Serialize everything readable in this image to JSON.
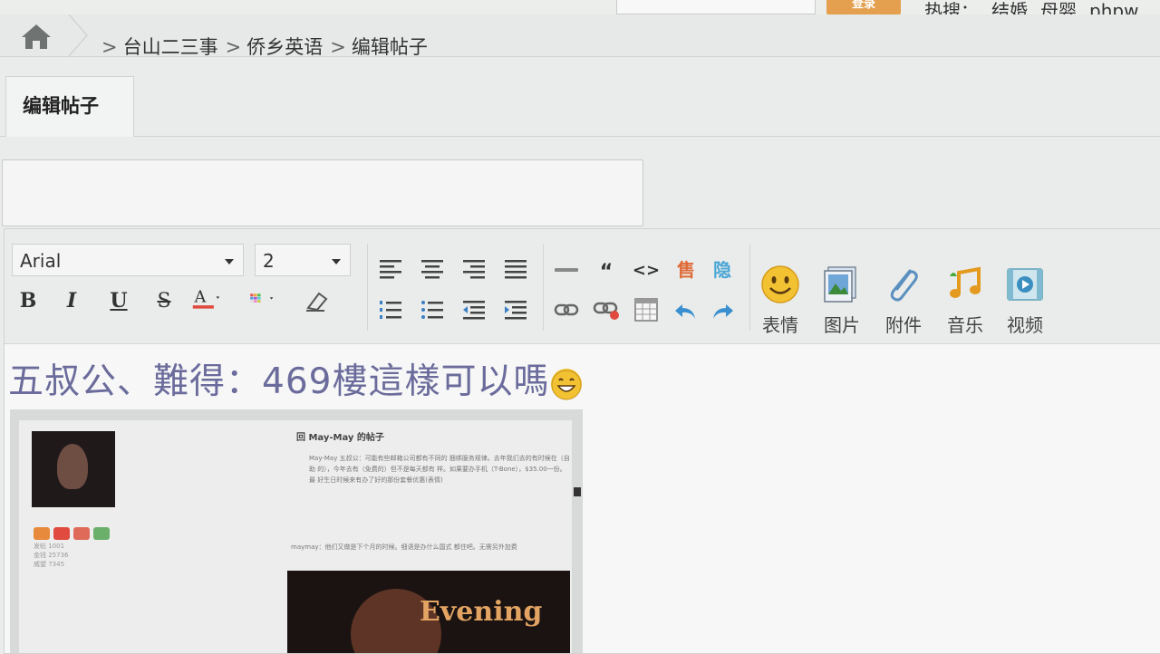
{
  "topbar": {
    "search_button": "登录",
    "hot_label": "热搜：",
    "hot_links": [
      "结婚",
      "母婴",
      "phpw"
    ]
  },
  "breadcrumb": {
    "separator": ">",
    "items": [
      "台山二三事",
      "侨乡英语",
      "编辑帖子"
    ]
  },
  "tab": {
    "label": "编辑帖子"
  },
  "title_input": {
    "value": ""
  },
  "toolbar": {
    "font_family": "Arial",
    "font_size": "2",
    "big_buttons": [
      {
        "label": "表情",
        "icon": "smiley-icon"
      },
      {
        "label": "图片",
        "icon": "image-icon"
      },
      {
        "label": "附件",
        "icon": "paperclip-icon"
      },
      {
        "label": "音乐",
        "icon": "music-icon"
      },
      {
        "label": "视频",
        "icon": "video-icon"
      }
    ],
    "hide_label": "隐",
    "sell_label": "售",
    "colors": {
      "font_color": "#e04a3f",
      "hide_color": "#4aa6d6",
      "sell_color": "#e06a36",
      "undo_color": "#3a8fd0"
    }
  },
  "content": {
    "text": "五叔公、難得：469樓這樣可以嗎",
    "text_color": "#6b6b9c",
    "screenshot": {
      "post_title": "回 May-May 的帖子",
      "quote_text": "May-May 五叔公：可能有些邮箱公司都有不同的 捆绑服务规律。去年我们去的有时候在（自助 的），今年去有（免费的）但不是每天都有 样。如果要办手机（T-Bone），$35.00一份。最 好生日时候来有办了好的那份套餐优惠(表情)",
      "reply_text": "maymay：他们又做是下个月的时候。细语是办什么国式 都住吧。无需另外加费",
      "video_caption": "Evening",
      "stats": [
        "发帖 1001",
        "金钱 25736",
        "威望 7345"
      ]
    }
  }
}
